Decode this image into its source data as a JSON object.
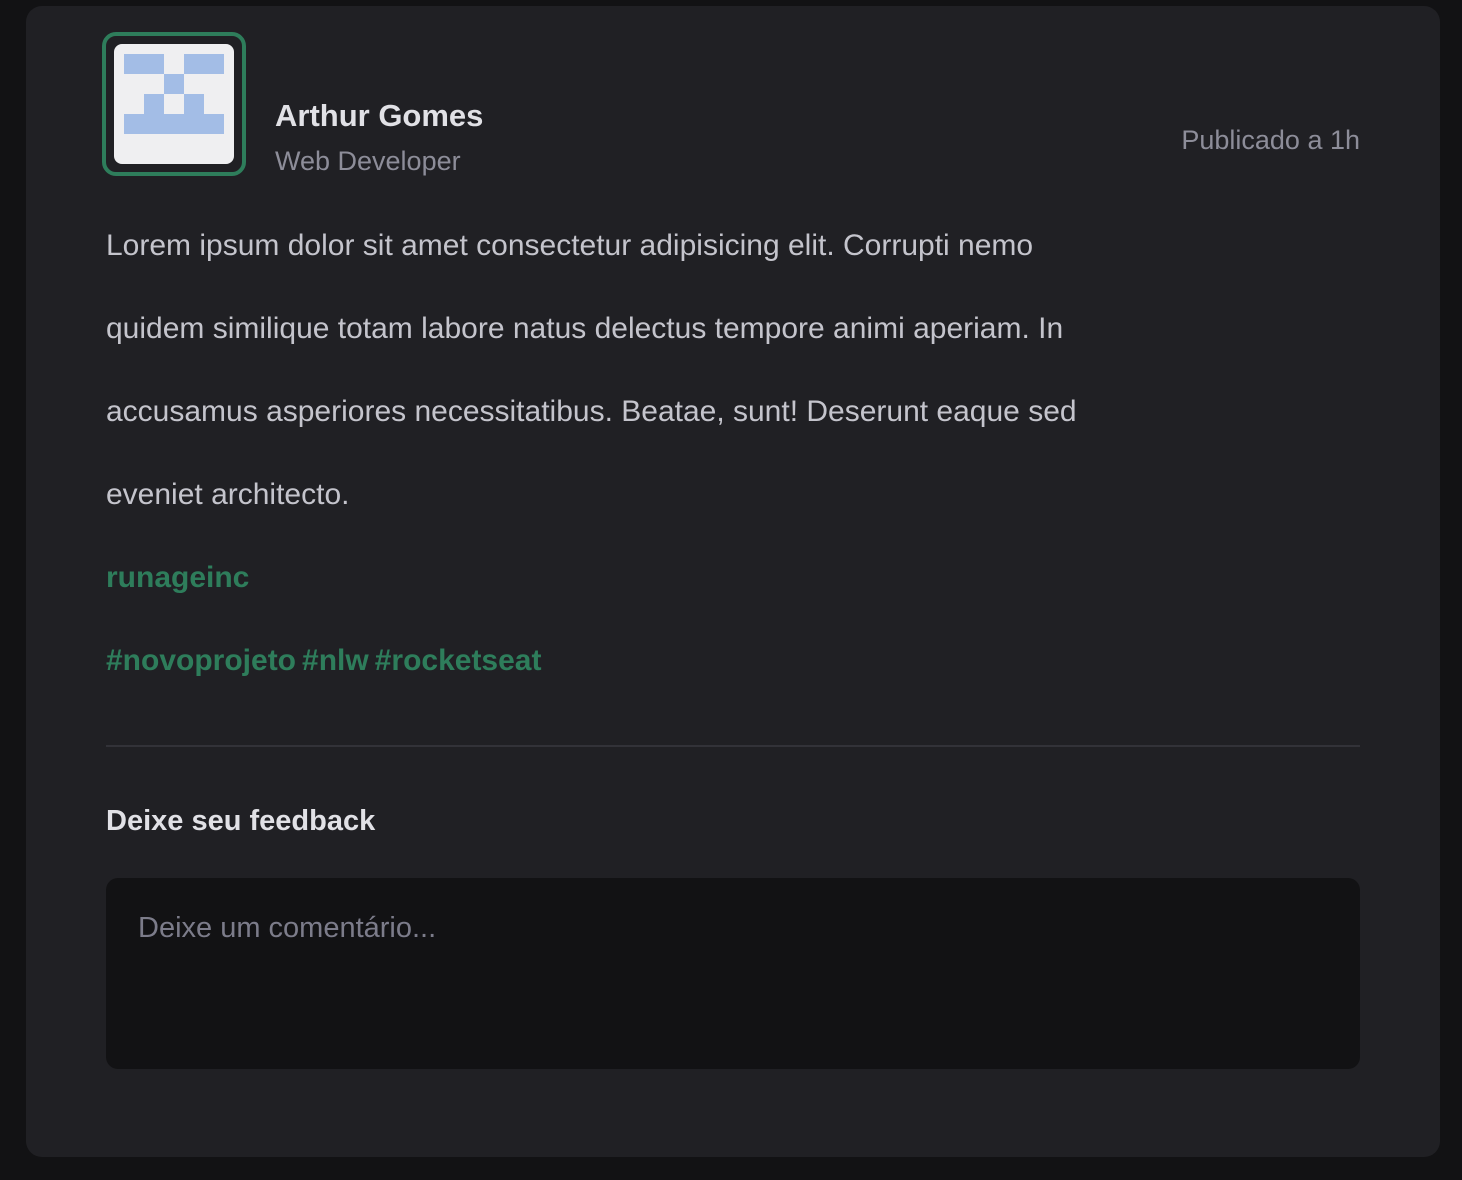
{
  "author": {
    "name": "Arthur Gomes",
    "role": "Web Developer",
    "avatar_icon": "identicon-avatar"
  },
  "post": {
    "published": "Publicado a 1h",
    "content_lines": [
      "Lorem ipsum dolor sit amet consectetur adipisicing elit. Corrupti nemo",
      "quidem similique totam labore natus delectus tempore animi aperiam. In",
      "accusamus asperiores necessitatibus. Beatae, sunt! Deserunt eaque sed",
      "eveniet architecto."
    ],
    "link": "runageinc",
    "hashtags": [
      "#novoprojeto",
      "#nlw",
      "#rocketseat"
    ]
  },
  "feedback": {
    "title": "Deixe seu feedback",
    "placeholder": "Deixe um comentário...",
    "value": ""
  },
  "colors": {
    "accent": "#2e7d5b",
    "card_bg": "#202024",
    "page_bg": "#121214",
    "avatar_blocks": "#a3bde6"
  }
}
